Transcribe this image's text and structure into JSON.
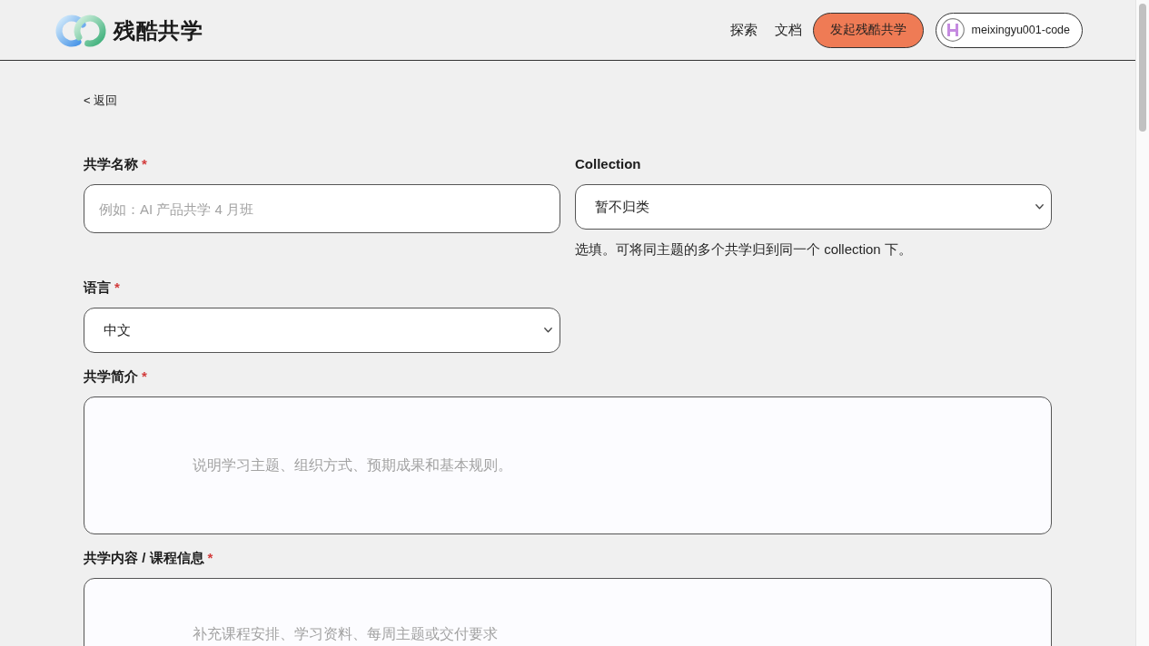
{
  "header": {
    "logo": {
      "text": "残酷共学"
    },
    "nav": [
      {
        "label": "探索"
      },
      {
        "label": "文档"
      }
    ],
    "primary_button": {
      "label": "发起残酷共学"
    },
    "user": {
      "name": "meixingyu001-code"
    }
  },
  "back_link": {
    "label": "< 返回"
  },
  "form": {
    "fields": [
      {
        "kind": "text",
        "label": "共学名称",
        "required_mark": "*",
        "placeholder": "例如：AI 产品共学 4 月班"
      },
      {
        "kind": "select",
        "label": "Collection",
        "value": "暂不归类",
        "help": "选填。可将同主题的多个共学归到同一个 collection 下。"
      },
      {
        "kind": "select",
        "label": "语言",
        "required_mark": "*",
        "value": "中文"
      },
      {
        "kind": "textarea",
        "label": "共学简介",
        "required_mark": "*",
        "placeholder": "说明学习主题、组织方式、预期成果和基本规则。"
      },
      {
        "kind": "textarea",
        "label": "共学内容 / 课程信息",
        "required_mark": "*",
        "placeholder": "补充课程安排、学习资料、每周主题或交付要求"
      }
    ]
  }
}
